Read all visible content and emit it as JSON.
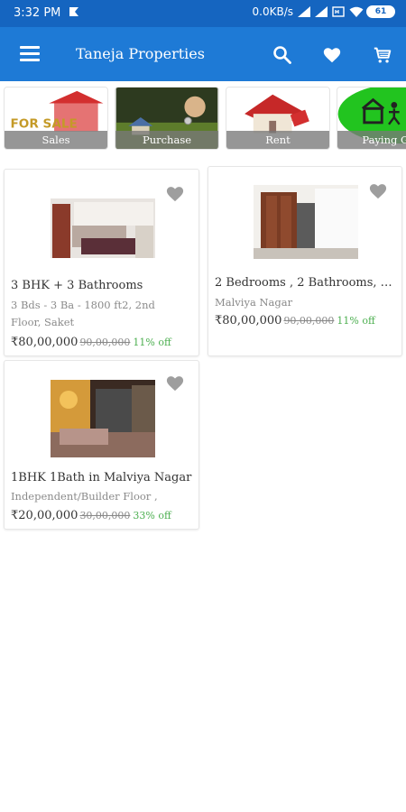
{
  "status_bar": {
    "time": "3:32 PM",
    "net_speed": "0.0KB/s",
    "battery": "61"
  },
  "app_bar": {
    "title": "Taneja Properties",
    "icons": [
      "menu-icon",
      "search-icon",
      "heart-icon",
      "cart-icon"
    ]
  },
  "categories": [
    {
      "label": "Sales",
      "art_text": "FOR SALE"
    },
    {
      "label": "Purchase"
    },
    {
      "label": "Rent"
    },
    {
      "label": "Paying Gu"
    }
  ],
  "listings": [
    {
      "title": "3 BHK + 3 Bathrooms",
      "desc_line1": "3 Bds - 3 Ba - 1800 ft2, 2nd",
      "desc_line2": "Floor, Saket",
      "price": "₹80,00,000",
      "mrp": "90,00,000",
      "discount": "11% off"
    },
    {
      "title": "2 Bedrooms , 2 Bathrooms, 1…",
      "desc_line1": "Malviya Nagar",
      "price": "₹80,00,000",
      "mrp": "90,00,000",
      "discount": "11% off"
    },
    {
      "title": "1BHK 1Bath in Malviya Nagar",
      "desc_line1": "Independent/Builder Floor ,",
      "price": "₹20,00,000",
      "mrp": "30,00,000",
      "discount": "33% off"
    }
  ],
  "colors": {
    "status_bar": "#1565c0",
    "app_bar": "#1e7ad6",
    "discount": "#4caf50",
    "favorite_icon": "#9e9e9e"
  }
}
